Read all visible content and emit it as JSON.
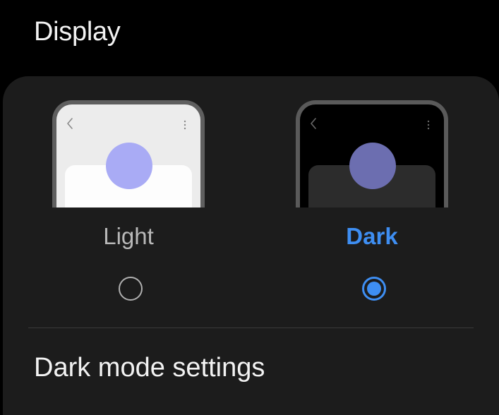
{
  "header": {
    "title": "Display"
  },
  "theme_options": [
    {
      "label": "Light",
      "selected": false,
      "preview_icon": "light-mode-preview-icon"
    },
    {
      "label": "Dark",
      "selected": true,
      "preview_icon": "dark-mode-preview-icon"
    }
  ],
  "settings_row": {
    "label": "Dark mode settings"
  },
  "colors": {
    "accent": "#3e8ef2",
    "background": "#000000",
    "card": "#1c1c1c",
    "preview_circle_light": "#a9abf5",
    "preview_circle_dark": "#6c6eb0"
  }
}
